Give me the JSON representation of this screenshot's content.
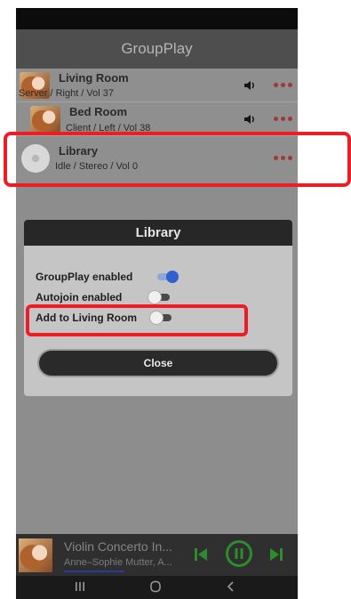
{
  "app": {
    "title": "GroupPlay"
  },
  "rooms": [
    {
      "name": "Living Room",
      "status": "Server / Right / Vol 37",
      "art": "portrait",
      "volume_icon": "speaker-icon"
    },
    {
      "name": "Bed Room",
      "status": "Client / Left / Vol 38",
      "art": "portrait",
      "volume_icon": "speaker-icon"
    },
    {
      "name": "Library",
      "status": "Idle / Stereo / Vol 0",
      "art": "disc"
    }
  ],
  "dialog": {
    "title": "Library",
    "options": [
      {
        "label": "GroupPlay enabled",
        "checked": true
      },
      {
        "label": "Autojoin enabled",
        "checked": false
      },
      {
        "label": "Add to Living Room",
        "checked": false
      }
    ],
    "close_label": "Close"
  },
  "player": {
    "title": "Violin Concerto In...",
    "artist": "Anne–Sophie Mutter, A...",
    "accent_color": "#2e8b2e"
  },
  "colors": {
    "highlight": "#ee1c25",
    "toggle_on": "#2f5fd0",
    "more_dots": "#9c3a3a"
  }
}
